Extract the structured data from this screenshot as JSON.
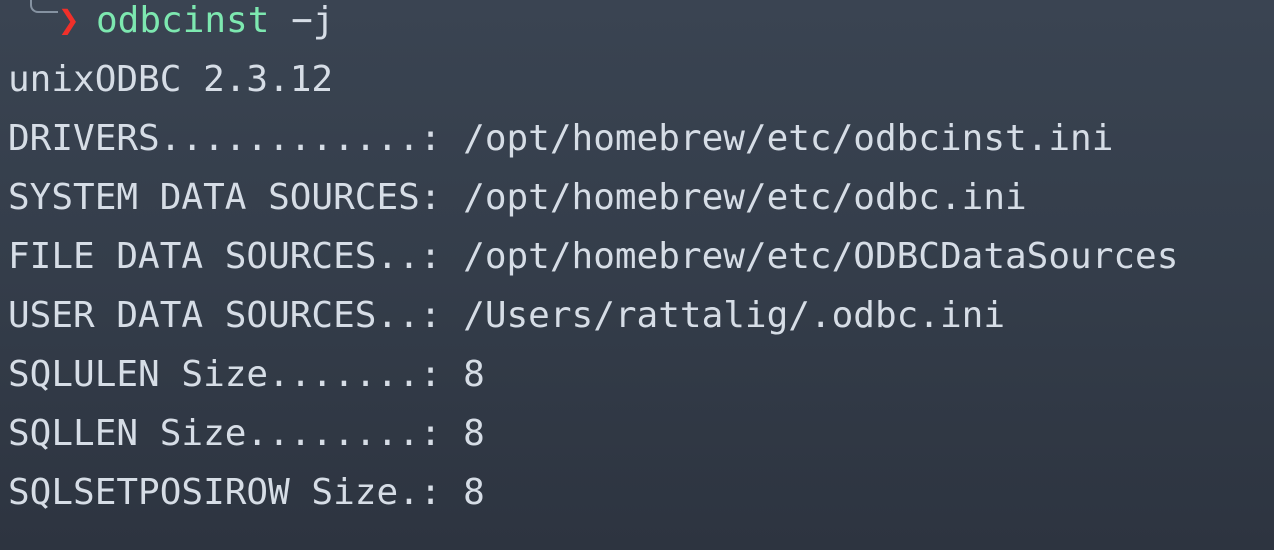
{
  "prompt": {
    "arrow": "❯",
    "command": "odbcinst",
    "args": " −j"
  },
  "output": {
    "version": "unixODBC 2.3.12",
    "lines": [
      "DRIVERS............: /opt/homebrew/etc/odbcinst.ini",
      "SYSTEM DATA SOURCES: /opt/homebrew/etc/odbc.ini",
      "FILE DATA SOURCES..: /opt/homebrew/etc/ODBCDataSources",
      "USER DATA SOURCES..: /Users/rattalig/.odbc.ini",
      "SQLULEN Size.......: 8",
      "SQLLEN Size........: 8",
      "SQLSETPOSIROW Size.: 8"
    ]
  },
  "colors": {
    "background": "#343d4a",
    "text": "#d6dde6",
    "command": "#7de8b0",
    "arrow": "#f0302a"
  }
}
